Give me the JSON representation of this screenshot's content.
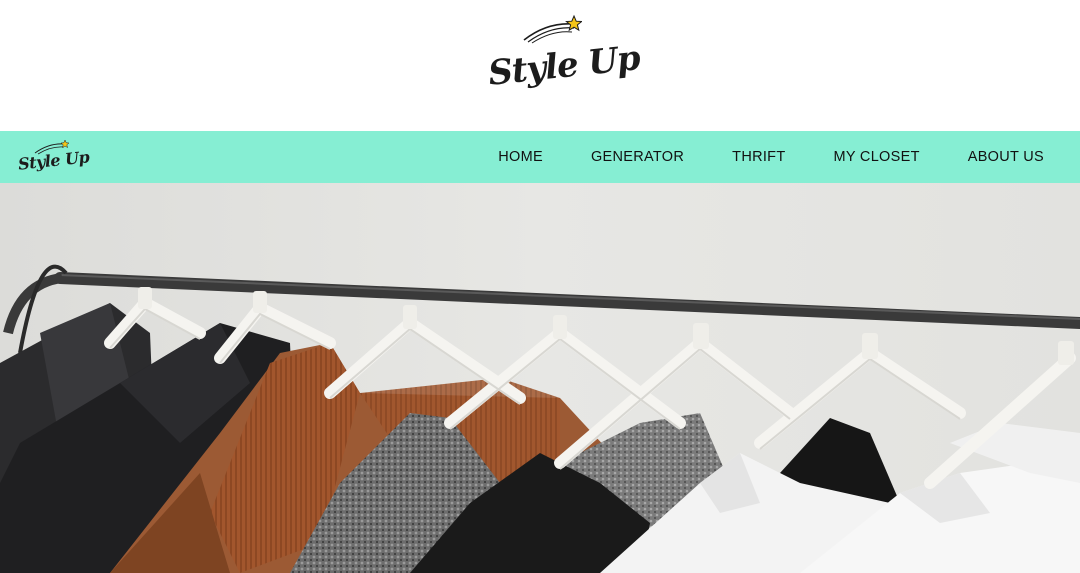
{
  "brand": {
    "name": "Style Up",
    "small_name": "Style Up"
  },
  "nav": {
    "items": [
      {
        "label": "HOME"
      },
      {
        "label": "GENERATOR"
      },
      {
        "label": "THRIFT"
      },
      {
        "label": "MY CLOSET"
      },
      {
        "label": "ABOUT US"
      }
    ]
  },
  "colors": {
    "nav_background": "#86eed3",
    "star": "#f5c518",
    "text": "#111111"
  },
  "hero": {
    "image": "hero-clothes-rack-image"
  }
}
